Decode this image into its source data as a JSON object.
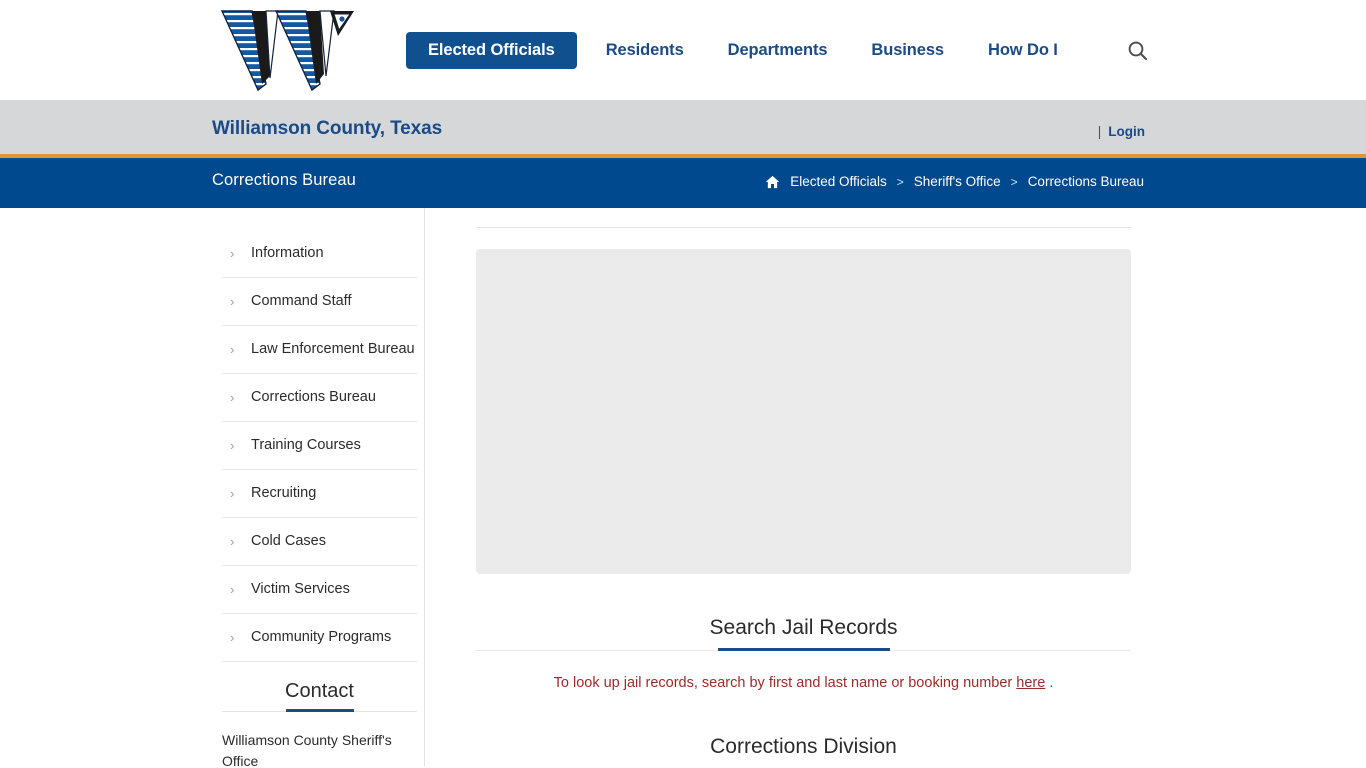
{
  "header": {
    "logo_alt": "Williamson County W logo",
    "nav": [
      {
        "label": "Elected Officials",
        "active": true
      },
      {
        "label": "Residents",
        "active": false
      },
      {
        "label": "Departments",
        "active": false
      },
      {
        "label": "Business",
        "active": false
      },
      {
        "label": "How Do I",
        "active": false
      }
    ],
    "search_icon": "search-icon"
  },
  "gray_band": {
    "county": "Williamson County, Texas",
    "separator": "|",
    "login": "Login"
  },
  "blue_bar": {
    "page_title": "Corrections Bureau",
    "home_icon": "home-icon",
    "breadcrumb": [
      {
        "label": "Elected Officials"
      },
      {
        "label": "Sheriff's Office"
      },
      {
        "label": "Corrections Bureau"
      }
    ],
    "breadcrumb_separator": ">"
  },
  "sidebar": {
    "items": [
      {
        "label": "Information"
      },
      {
        "label": "Command Staff"
      },
      {
        "label": "Law Enforcement Bureau"
      },
      {
        "label": "Corrections Bureau"
      },
      {
        "label": "Training Courses"
      },
      {
        "label": "Recruiting"
      },
      {
        "label": "Cold Cases"
      },
      {
        "label": "Victim Services"
      },
      {
        "label": "Community Programs"
      }
    ],
    "chevron": "›",
    "contact_heading": "Contact",
    "contact_name": "Williamson County Sheriff's Office"
  },
  "main": {
    "search_jail_heading": "Search Jail Records",
    "note_prefix": "To look up jail records, search by first and last name or booking number",
    "note_link": "here",
    "note_suffix": ".",
    "corrections_division_heading": "Corrections Division"
  },
  "colors": {
    "brand_blue": "#00498f",
    "nav_blue": "#11508f",
    "text_blue": "#1b4b87",
    "orange_rule": "#e8912d",
    "gray_band": "#d5d7d9",
    "note_red": "#9c2b2b",
    "placeholder_gray": "#ebebeb"
  }
}
